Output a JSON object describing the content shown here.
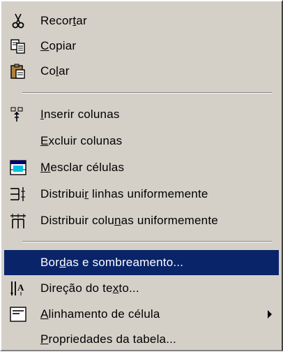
{
  "menu": {
    "items": [
      {
        "id": "cut",
        "before": "Recor",
        "key": "t",
        "after": "ar",
        "icon": "scissors-icon"
      },
      {
        "id": "copy",
        "before": "",
        "key": "C",
        "after": "opiar",
        "icon": "copy-icon"
      },
      {
        "id": "paste",
        "before": "Co",
        "key": "l",
        "after": "ar",
        "icon": "paste-icon"
      },
      {
        "id": "insert-columns",
        "before": "",
        "key": "I",
        "after": "nserir colunas",
        "icon": "insert-columns-icon"
      },
      {
        "id": "delete-columns",
        "before": "",
        "key": "E",
        "after": "xcluir colunas",
        "icon": ""
      },
      {
        "id": "merge-cells",
        "before": "",
        "key": "M",
        "after": "esclar células",
        "icon": "merge-cells-icon"
      },
      {
        "id": "distribute-rows",
        "before": "Distribui",
        "key": "r",
        "after": " linhas uniformemente",
        "icon": "distribute-rows-icon"
      },
      {
        "id": "distribute-columns",
        "before": "Distribuir colu",
        "key": "n",
        "after": "as uniformemente",
        "icon": "distribute-columns-icon"
      },
      {
        "id": "borders-shading",
        "before": "Bor",
        "key": "d",
        "after": "as e sombreamento...",
        "icon": "",
        "highlighted": true
      },
      {
        "id": "text-direction",
        "before": "Direção do te",
        "key": "x",
        "after": "to...",
        "icon": "text-direction-icon"
      },
      {
        "id": "cell-alignment",
        "before": "",
        "key": "A",
        "after": "linhamento de célula",
        "icon": "cell-alignment-icon",
        "submenu": true
      },
      {
        "id": "table-properties",
        "before": "",
        "key": "P",
        "after": "ropriedades da tabela...",
        "icon": ""
      }
    ]
  },
  "colors": {
    "menu_bg": "#d4d0c8",
    "highlight_bg": "#0a246a",
    "highlight_text": "#ffffff"
  }
}
